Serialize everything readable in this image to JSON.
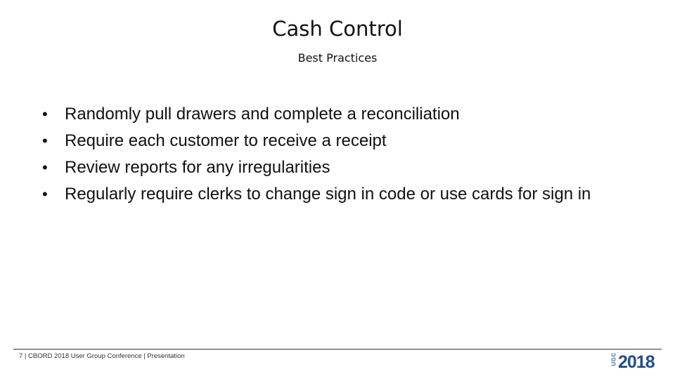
{
  "slide": {
    "title": "Cash Control",
    "subtitle": "Best Practices",
    "bullets": [
      "Randomly pull drawers and complete a reconciliation",
      "Require each customer to receive a receipt",
      "Review reports for any irregularities",
      "Regularly require clerks to change sign in code or use cards for sign in"
    ],
    "bullet_glyph": "•"
  },
  "footer": {
    "text": "7 |  CBORD 2018 User Group Conference | Presentation",
    "logo": {
      "prefix": "UGC",
      "year": "2018",
      "colors": {
        "primary": "#1f4e8c",
        "secondary": "#3a6aa8"
      }
    }
  }
}
